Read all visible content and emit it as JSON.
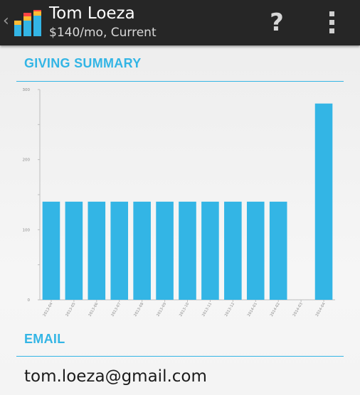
{
  "header": {
    "back_glyph": "‹",
    "title": "Tom Loeza",
    "subtitle": "$140/mo, Current",
    "help_glyph": "?",
    "icons": [
      "app-logo-icon",
      "help-icon",
      "overflow-menu-icon"
    ]
  },
  "sections": {
    "giving_summary_label": "GIVING SUMMARY",
    "email_label": "EMAIL"
  },
  "email": {
    "value": "tom.loeza@gmail.com"
  },
  "colors": {
    "accent": "#33b5e5",
    "action_bar": "#262626",
    "logo_bars": [
      "#33b5e5",
      "#ffbb33",
      "#ff4444"
    ]
  },
  "chart_data": {
    "type": "bar",
    "categories": [
      "2013-04",
      "2013-05",
      "2013-06",
      "2013-07",
      "2013-08",
      "2013-09",
      "2013-10",
      "2013-11",
      "2013-12",
      "2014-01",
      "2014-02",
      "2014-03",
      "2014-04"
    ],
    "values": [
      140,
      140,
      140,
      140,
      140,
      140,
      140,
      140,
      140,
      140,
      140,
      0,
      280
    ],
    "ylim": [
      0,
      300
    ],
    "yticks": [
      0,
      100,
      200,
      300
    ],
    "grid": false,
    "legend": "none",
    "bar_color": "#33b5e5"
  }
}
